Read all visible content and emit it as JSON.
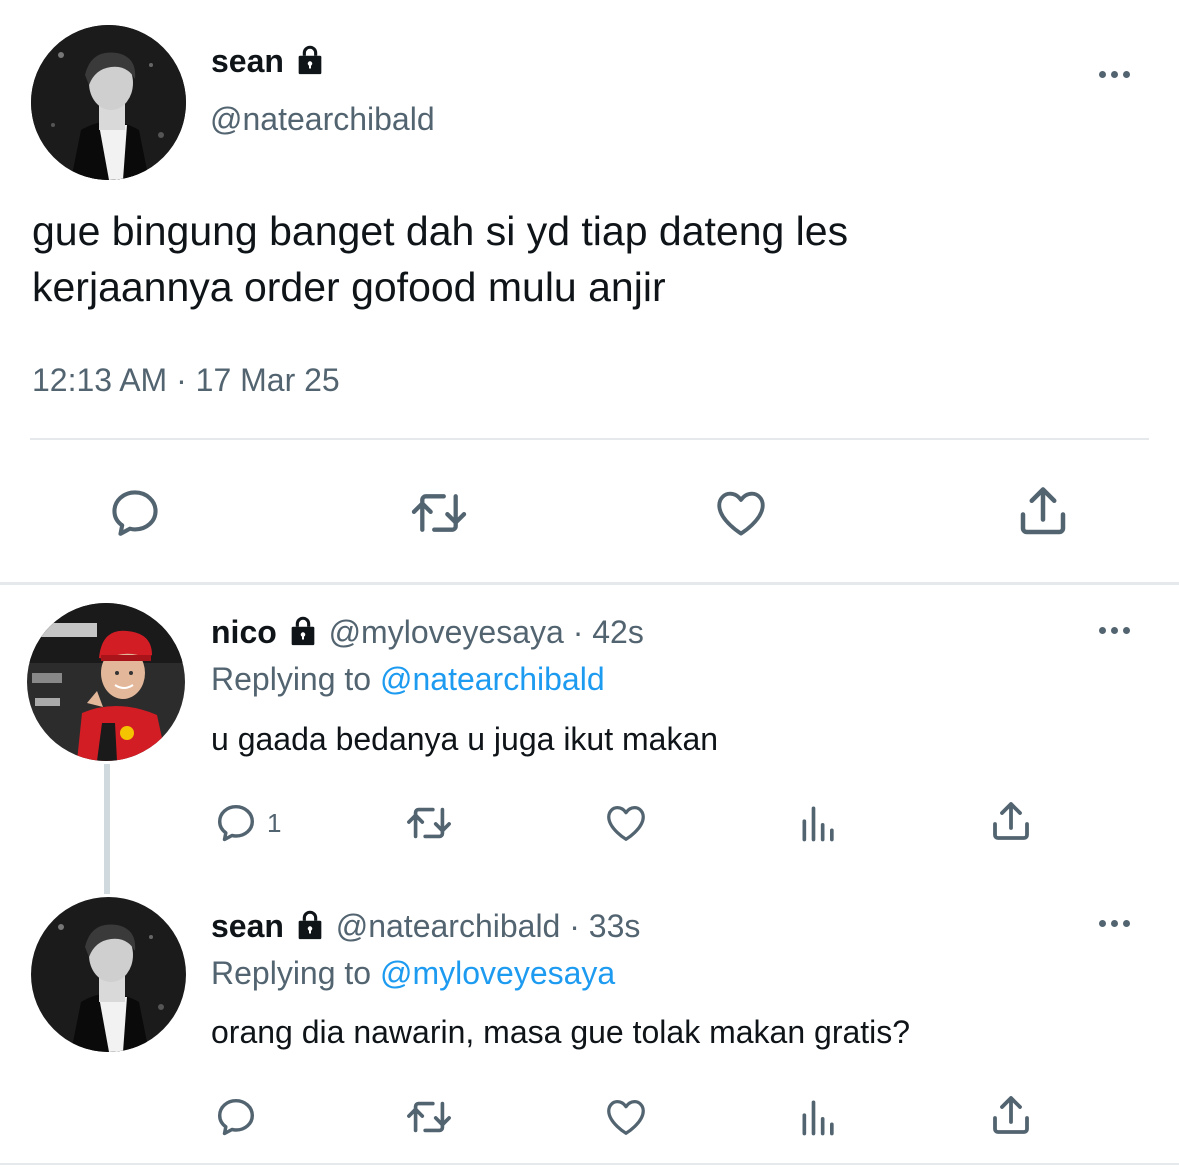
{
  "main_tweet": {
    "display_name": "sean",
    "handle": "@natearchibald",
    "text_line1": "gue bingung banget dah si yd tiap dateng les",
    "text_line2": "kerjaannya order gofood mulu anjir",
    "timestamp": "12:13 AM · 17 Mar 25",
    "actions": [
      "reply-icon",
      "retweet-icon",
      "like-icon",
      "share-icon"
    ]
  },
  "replies": [
    {
      "display_name": "nico",
      "handle": "@myloveyesaya",
      "time": "· 42s",
      "replying_prefix": "Replying to ",
      "replying_to": "@natearchibald",
      "text": "u gaada bedanya u juga ikut makan",
      "reply_count": "1"
    },
    {
      "display_name": "sean",
      "handle": "@natearchibald",
      "time": "· 33s",
      "replying_prefix": "Replying to ",
      "replying_to": "@myloveyesaya",
      "text": "orang dia nawarin, masa gue tolak makan gratis?",
      "reply_count": ""
    }
  ],
  "colors": {
    "text": "#0f1419",
    "muted": "#536471",
    "link": "#1d9bf0",
    "divider": "#e6e9ec"
  }
}
